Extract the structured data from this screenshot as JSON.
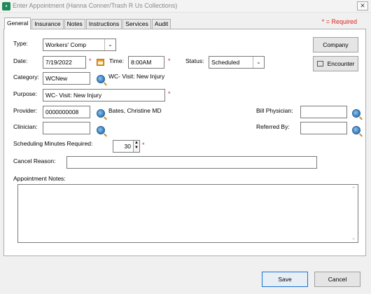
{
  "window": {
    "title": "Enter Appointment (Hanna Conner/Trash R Us Collections)",
    "close": "✕"
  },
  "required_note": "* = Required",
  "tabs": [
    "General",
    "Insurance",
    "Notes",
    "Instructions",
    "Services",
    "Audit"
  ],
  "form": {
    "type_label": "Type:",
    "type_value": "Workers' Comp",
    "date_label": "Date:",
    "date_value": "7/19/2022",
    "time_label": "Time:",
    "time_value": "8:00AM",
    "status_label": "Status:",
    "status_value": "Scheduled",
    "category_label": "Category:",
    "category_value": "WCNew",
    "category_desc": "WC- Visit: New Injury",
    "purpose_label": "Purpose:",
    "purpose_value": "WC- Visit: New Injury",
    "provider_label": "Provider:",
    "provider_value": "0000000008",
    "provider_name": "Bates, Christine  MD",
    "bill_physician_label": "Bill Physician:",
    "bill_physician_value": "",
    "clinician_label": "Clinician:",
    "clinician_value": "",
    "referred_by_label": "Referred By:",
    "referred_by_value": "",
    "minutes_label": "Scheduling Minutes Required:",
    "minutes_value": "30",
    "cancel_reason_label": "Cancel Reason:",
    "cancel_reason_value": "",
    "notes_label": "Appointment Notes:",
    "notes_value": ""
  },
  "buttons": {
    "company": "Company",
    "encounter": "Encounter",
    "save": "Save",
    "cancel": "Cancel"
  },
  "req_marker": "*",
  "arrow": "⌄",
  "spin_up": "▲",
  "spin_down": "▼"
}
